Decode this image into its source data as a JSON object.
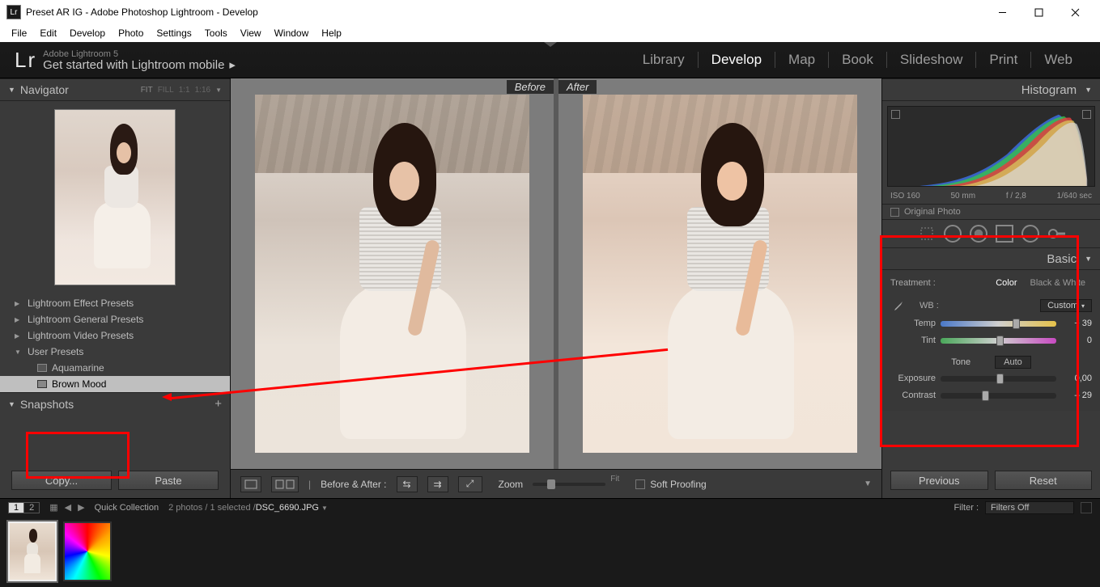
{
  "window": {
    "title": "Preset AR IG - Adobe Photoshop Lightroom - Develop"
  },
  "os_menu": [
    "File",
    "Edit",
    "Develop",
    "Photo",
    "Settings",
    "Tools",
    "View",
    "Window",
    "Help"
  ],
  "identity": {
    "line1": "Adobe Lightroom 5",
    "line2": "Get started with Lightroom mobile"
  },
  "modules": [
    "Library",
    "Develop",
    "Map",
    "Book",
    "Slideshow",
    "Print",
    "Web"
  ],
  "modules_active": "Develop",
  "navigator": {
    "title": "Navigator",
    "modes": [
      "FIT",
      "FILL",
      "1:1",
      "1:16"
    ]
  },
  "presets": {
    "folders": [
      {
        "label": "Lightroom Effect Presets",
        "open": false
      },
      {
        "label": "Lightroom General Presets",
        "open": false
      },
      {
        "label": "Lightroom Video Presets",
        "open": false
      },
      {
        "label": "User Presets",
        "open": true,
        "items": [
          {
            "label": "Aquamarine",
            "selected": false
          },
          {
            "label": "Brown Mood",
            "selected": true
          }
        ]
      }
    ]
  },
  "snapshots": {
    "title": "Snapshots"
  },
  "copy_paste": {
    "copy": "Copy...",
    "paste": "Paste"
  },
  "before_after": {
    "before": "Before",
    "after": "After"
  },
  "center_toolbar": {
    "label": "Before & After :",
    "zoom": "Zoom",
    "fit": "Fit",
    "soft_proofing": "Soft Proofing"
  },
  "histogram": {
    "title": "Histogram",
    "iso": "ISO 160",
    "focal": "50 mm",
    "aperture": "f / 2,8",
    "shutter": "1/640 sec",
    "original": "Original Photo"
  },
  "basic": {
    "title": "Basic",
    "treatment_label": "Treatment :",
    "color": "Color",
    "bw": "Black & White",
    "wb_label": "WB :",
    "wb_value": "Custom",
    "temp_label": "Temp",
    "temp_value": "+ 39",
    "tint_label": "Tint",
    "tint_value": "0",
    "tone_label": "Tone",
    "auto": "Auto",
    "exposure_label": "Exposure",
    "exposure_value": "0,00",
    "contrast_label": "Contrast",
    "contrast_value": "– 29"
  },
  "prev_reset": {
    "previous": "Previous",
    "reset": "Reset"
  },
  "filterbar": {
    "quick": "Quick Collection",
    "count": "2 photos / 1 selected /",
    "filename": "DSC_6690.JPG",
    "filter_label": "Filter :",
    "filter_value": "Filters Off"
  }
}
